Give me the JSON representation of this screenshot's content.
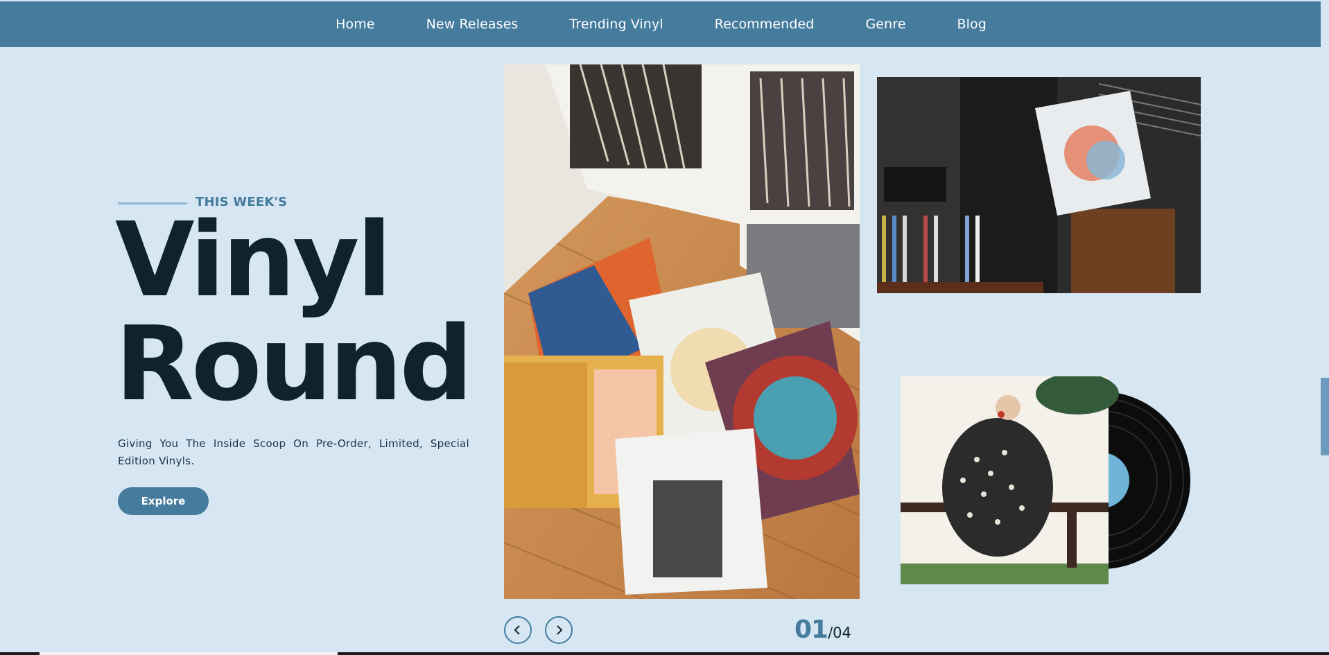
{
  "nav": {
    "items": [
      {
        "label": "Home"
      },
      {
        "label": "New Releases"
      },
      {
        "label": "Trending Vinyl"
      },
      {
        "label": "Recommended"
      },
      {
        "label": "Genre"
      },
      {
        "label": "Blog"
      }
    ]
  },
  "hero": {
    "eyebrow": "THIS WEEK'S",
    "title_line1": "Vinyl",
    "title_line2": "Round",
    "subtitle": "Giving You The Inside Scoop On Pre-Order, Limited, Special Edition Vinyls.",
    "cta_label": "Explore"
  },
  "carousel": {
    "current": "01",
    "total": "/04",
    "prev_icon": "chevron-left-icon",
    "next_icon": "chevron-right-icon"
  },
  "images": {
    "main": "vinyl records on wooden floor beside shelf",
    "top_right": "person holding vinyl album sleeve",
    "bottom_right": "album cover with vinyl record"
  },
  "colors": {
    "page_bg": "#d6e7f3",
    "nav_bg": "#457b9d",
    "accent": "#457b9d",
    "title": "#10222e"
  }
}
